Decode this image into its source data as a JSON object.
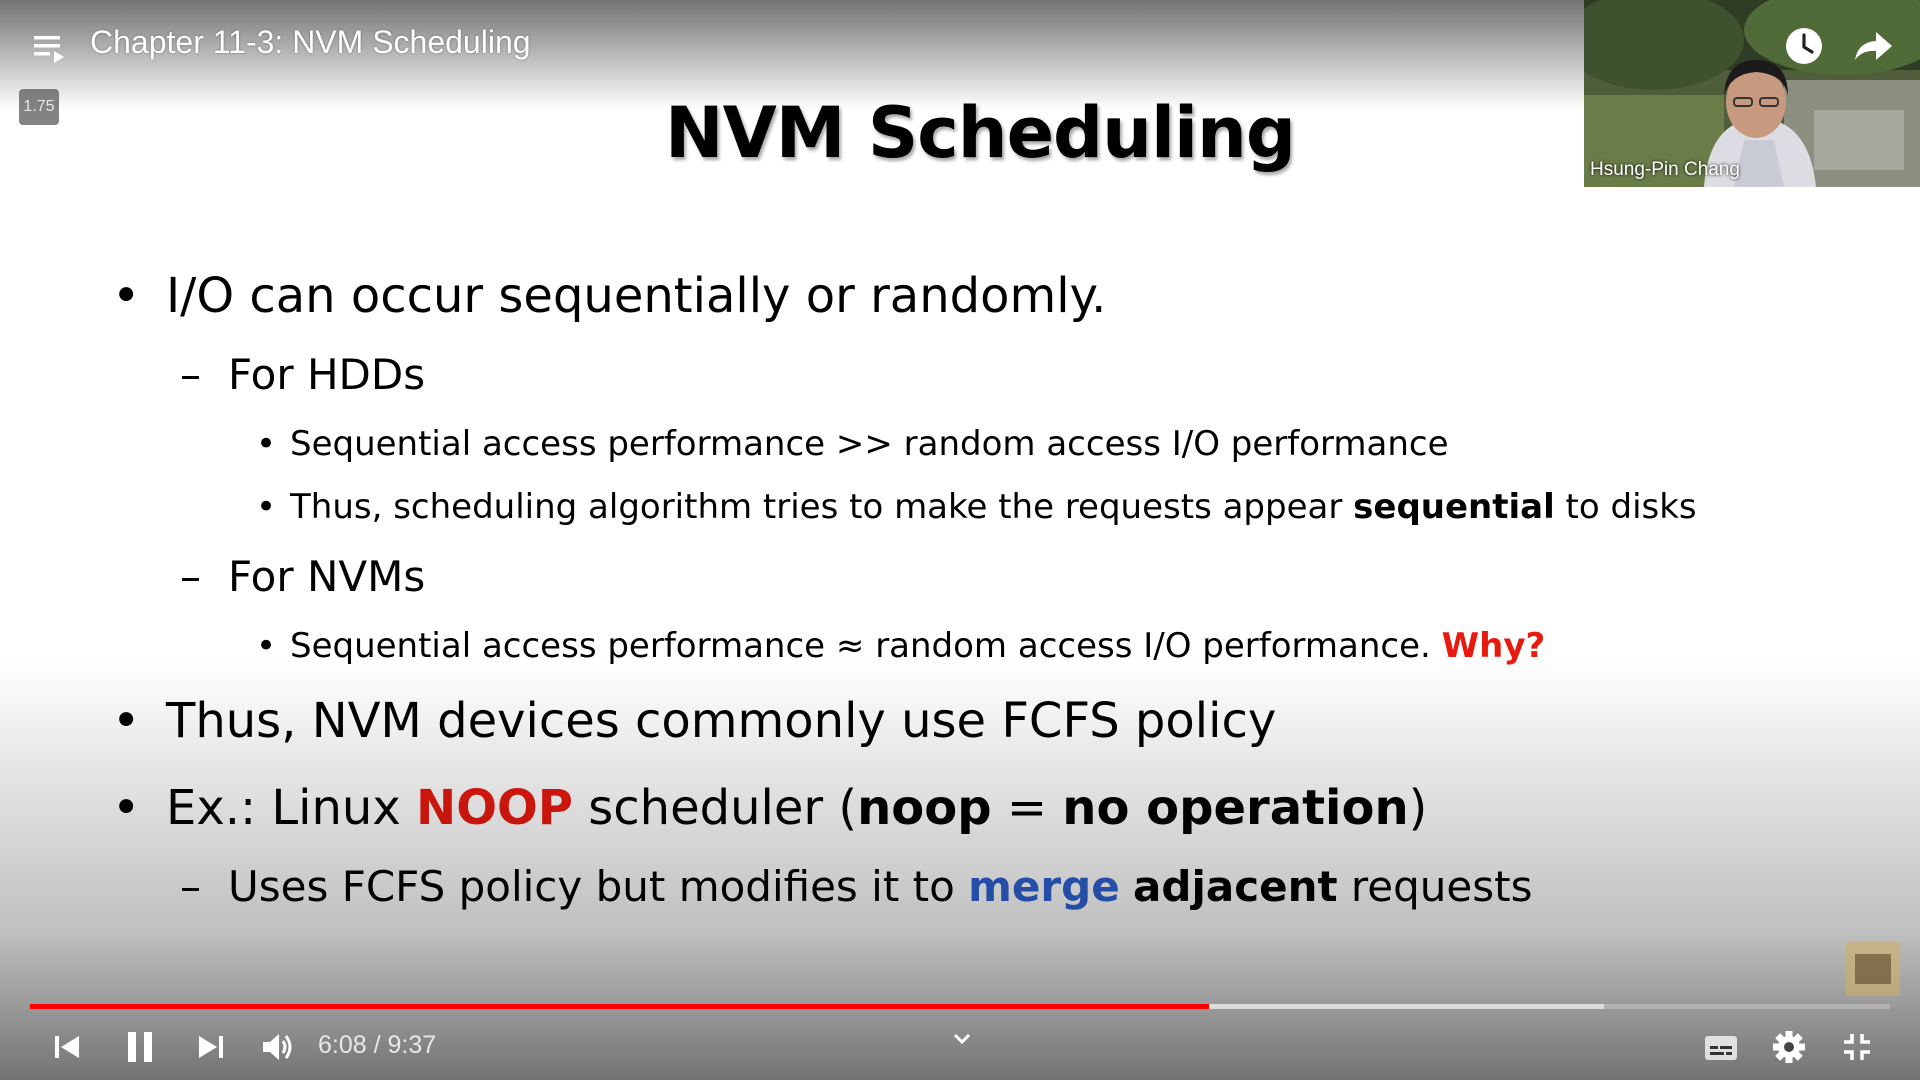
{
  "player": {
    "title": "Chapter 11-3: NVM Scheduling",
    "speed": "1.75",
    "time_current": "6:08",
    "time_separator": " / ",
    "time_total": "9:37",
    "progress": {
      "played_fraction": 0.634,
      "buffered_fraction": 0.846
    },
    "colors": {
      "played": "#ff0000",
      "accent_red": "#e8190f",
      "accent_blue": "#2f62d3"
    },
    "icons": {
      "top": [
        "playlist-icon",
        "watch-later-icon",
        "share-icon"
      ],
      "controls": [
        "previous-icon",
        "pause-icon",
        "next-icon",
        "volume-icon",
        "chevron-down-icon",
        "subtitles-icon",
        "settings-gear-icon",
        "exit-fullscreen-icon"
      ]
    }
  },
  "webcam": {
    "name": "Hsung-Pin Chang"
  },
  "slide": {
    "title": "NVM Scheduling",
    "bullet_marker": "•",
    "dash_marker": "–",
    "b1": "I/O can occur sequentially or randomly.",
    "hdd_heading": "For HDDs",
    "hdd_b1": "Sequential access performance >> random access I/O performance",
    "hdd_b2_pre": "Thus, scheduling algorithm tries to make the requests appear ",
    "hdd_b2_bold": "sequential",
    "hdd_b2_post": " to disks",
    "nvm_heading": "For NVMs",
    "nvm_b1_pre": "Sequential access performance ≈ random access I/O performance. ",
    "nvm_b1_why": "Why?",
    "b2": "Thus, NVM devices commonly use FCFS policy",
    "b3_pre": "Ex.: Linux ",
    "b3_noop": "NOOP",
    "b3_mid": " scheduler (",
    "b3_noop_lower": "noop",
    "b3_eq": " = ",
    "b3_no_op": "no operation",
    "b3_close": ")",
    "sub3_pre": "Uses FCFS policy but modifies it to ",
    "sub3_merge": "merge",
    "sub3_space": " ",
    "sub3_adjacent": "adjacent",
    "sub3_post": " requests"
  }
}
